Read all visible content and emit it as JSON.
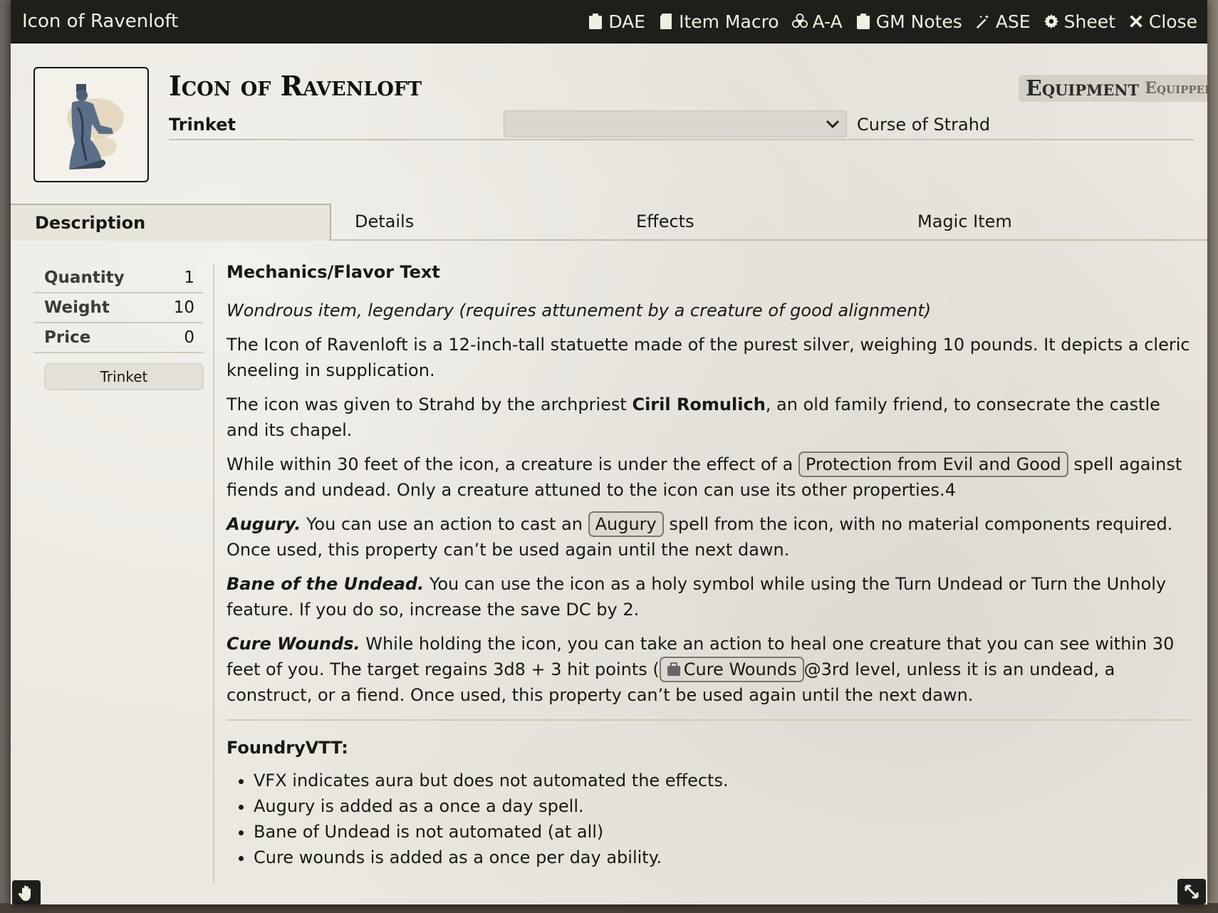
{
  "window": {
    "title": "Icon of Ravenloft",
    "header_buttons": [
      {
        "label": "DAE",
        "icon": "clipboard-icon"
      },
      {
        "label": "Item Macro",
        "icon": "sd-card-icon"
      },
      {
        "label": "A-A",
        "icon": "biohazard-icon"
      },
      {
        "label": "GM Notes",
        "icon": "clipboard-icon"
      },
      {
        "label": "ASE",
        "icon": "magic-wand-icon"
      },
      {
        "label": "Sheet",
        "icon": "gear-icon"
      },
      {
        "label": "Close",
        "icon": "close-icon"
      }
    ]
  },
  "item": {
    "name": "Icon of Ravenloft",
    "type": "Equipment",
    "status": "Equipped",
    "subtype": "Trinket",
    "select_value": "",
    "source": "Curse of Strahd"
  },
  "tabs": [
    "Description",
    "Details",
    "Effects",
    "Magic Item"
  ],
  "sidebar": {
    "props": [
      {
        "label": "Quantity",
        "value": "1"
      },
      {
        "label": "Weight",
        "value": "10"
      },
      {
        "label": "Price",
        "value": "0"
      }
    ],
    "tag": "Trinket"
  },
  "content": {
    "heading": "Mechanics/Flavor Text",
    "intro": "Wondrous item, legendary (requires attunement by a creature of good alignment)",
    "p1": "The Icon of Ravenloft is a 12-inch-tall statuette made of the purest silver, weighing 10 pounds. It depicts a cleric kneeling in supplication.",
    "p2": {
      "pre": "The icon was given to Strahd by the archpriest ",
      "bold": "Ciril Romulich",
      "post": ", an old family friend, to consecrate the castle and its chapel."
    },
    "p3": {
      "pre": "While within 30 feet of the icon, a creature is under the effect of a ",
      "link": "Protection from Evil and Good",
      "post": " spell against fiends and undead. Only a creature attuned to the icon can use its other properties.4"
    },
    "augury": {
      "title": "Augury.",
      "pre": " You can use an action to cast an ",
      "link": "Augury",
      "post": " spell from the icon, with no material components required. Once used, this property can’t be used again until the next dawn."
    },
    "bane": {
      "title": "Bane of the Undead.",
      "text": " You can use the icon as a holy symbol while using the Turn Undead or Turn the Unholy feature. If you do so, increase the save DC by 2."
    },
    "cure": {
      "title": "Cure Wounds.",
      "pre": " While holding the icon, you can take an action to heal one creature that you can see within 30 feet of you. The target regains 3d8 + 3 hit points (",
      "link": "Cure Wounds",
      "post": "@3rd level, unless it is an undead, a construct, or a fiend. Once used, this property can’t be used again until the next dawn."
    },
    "foundry_heading": "FoundryVTT:",
    "foundry_notes": [
      "VFX indicates aura but does not automated the effects.",
      "Augury is added as a once a day spell.",
      "Bane of Undead is not automated (at all)",
      "Cure wounds is added as a once per day ability."
    ]
  },
  "colors": {
    "titlebar": "#1f1e1a",
    "parchment": "#ebe8e0",
    "text": "#191813"
  }
}
